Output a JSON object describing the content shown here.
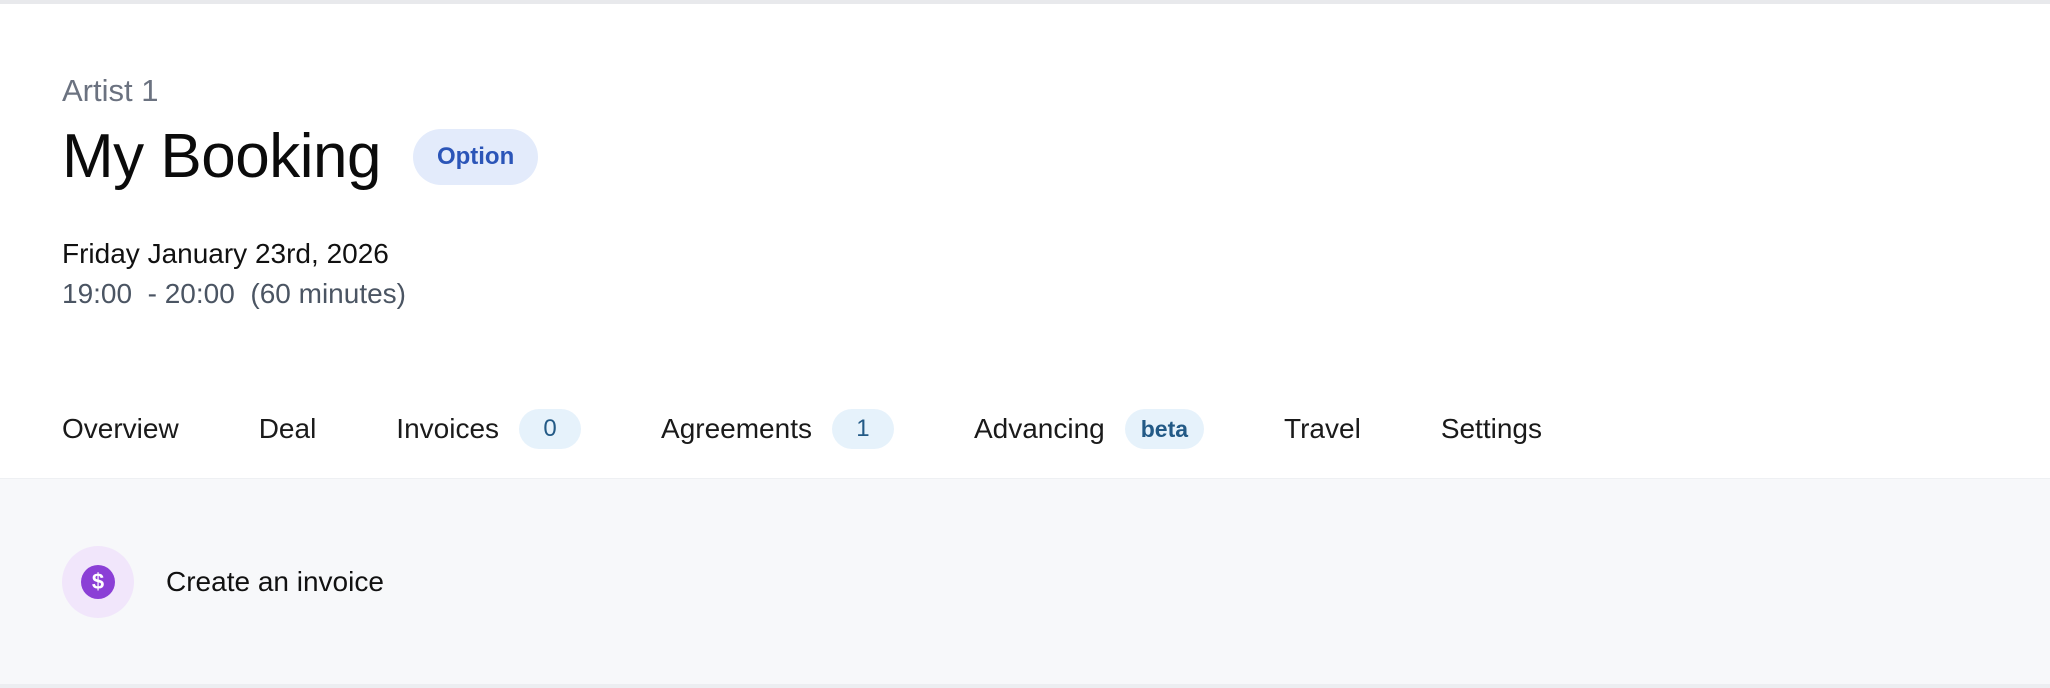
{
  "booking": {
    "artist": "Artist 1",
    "title": "My Booking",
    "status": "Option",
    "date": "Friday January 23rd, 2026",
    "time_range": "19:00  - 20:00",
    "duration": "(60 minutes)"
  },
  "tabs": [
    {
      "label": "Overview",
      "active": false
    },
    {
      "label": "Deal",
      "active": false
    },
    {
      "label": "Invoices",
      "count": "0",
      "active": true
    },
    {
      "label": "Agreements",
      "count": "1",
      "active": false
    },
    {
      "label": "Advancing",
      "count": "beta",
      "active": false
    },
    {
      "label": "Travel",
      "active": false
    },
    {
      "label": "Settings",
      "active": false
    }
  ],
  "invoices": {
    "create_label": "Create an invoice",
    "icon": "dollar-icon",
    "icon_glyph": "$"
  },
  "colors": {
    "status_badge_bg": "#e3ebfb",
    "status_badge_text": "#2b55b8",
    "active_tab_underline": "#4a86c4",
    "count_badge_bg": "#e6f2fb",
    "invoice_icon": "#8b3fd6",
    "content_bg": "#f7f8fa"
  }
}
